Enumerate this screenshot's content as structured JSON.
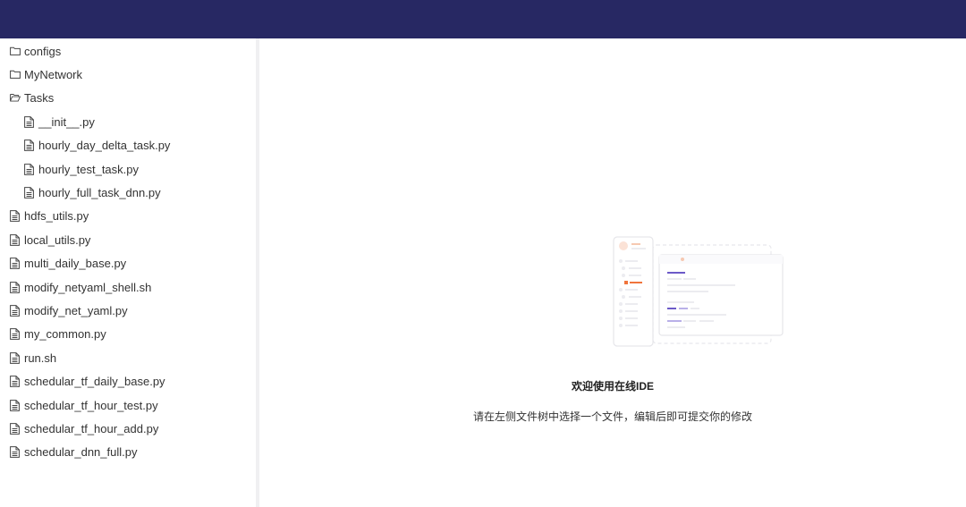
{
  "sidebar": {
    "items": [
      {
        "label": "configs",
        "type": "folder",
        "level": 0
      },
      {
        "label": "MyNetwork",
        "type": "folder",
        "level": 0
      },
      {
        "label": "Tasks",
        "type": "folder-open",
        "level": 0
      },
      {
        "label": "__init__.py",
        "type": "file",
        "level": 1
      },
      {
        "label": "hourly_day_delta_task.py",
        "type": "file",
        "level": 1
      },
      {
        "label": "hourly_test_task.py",
        "type": "file",
        "level": 1
      },
      {
        "label": "hourly_full_task_dnn.py",
        "type": "file",
        "level": 1
      },
      {
        "label": "hdfs_utils.py",
        "type": "file",
        "level": 0
      },
      {
        "label": "local_utils.py",
        "type": "file",
        "level": 0
      },
      {
        "label": "multi_daily_base.py",
        "type": "file",
        "level": 0
      },
      {
        "label": "modify_netyaml_shell.sh",
        "type": "file",
        "level": 0
      },
      {
        "label": "modify_net_yaml.py",
        "type": "file",
        "level": 0
      },
      {
        "label": "my_common.py",
        "type": "file",
        "level": 0
      },
      {
        "label": "run.sh",
        "type": "file",
        "level": 0
      },
      {
        "label": "schedular_tf_daily_base.py",
        "type": "file",
        "level": 0
      },
      {
        "label": "schedular_tf_hour_test.py",
        "type": "file",
        "level": 0
      },
      {
        "label": "schedular_tf_hour_add.py",
        "type": "file",
        "level": 0
      },
      {
        "label": "schedular_dnn_full.py",
        "type": "file",
        "level": 0
      }
    ]
  },
  "icons": {
    "folder": "folder-icon",
    "folder-open": "folder-open-icon",
    "file": "file-icon"
  },
  "main": {
    "title": "欢迎使用在线IDE",
    "subtitle": "请在左侧文件树中选择一个文件，编辑后即可提交你的修改"
  },
  "colors": {
    "header": "#272863",
    "accent_orange": "#f0743c",
    "accent_purple": "#6c5ac8"
  }
}
